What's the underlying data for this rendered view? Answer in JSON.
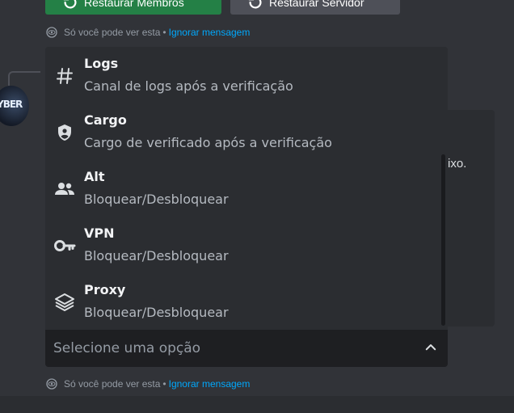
{
  "buttons": {
    "restore_members": "Restaurar Membros",
    "restore_server": "Restaurar Servidor"
  },
  "ephemeral": {
    "only_you": "Só você pode ver esta",
    "separator": "•",
    "dismiss": "Ignorar mensagem"
  },
  "avatar": {
    "text": "YBER"
  },
  "embed": {
    "partial_text": "ixo."
  },
  "menu": {
    "options": [
      {
        "icon": "hashtag-icon",
        "title": "Logs",
        "description": "Canal de logs após a verificação"
      },
      {
        "icon": "shield-user-icon",
        "title": "Cargo",
        "description": "Cargo de verificado após a verificação"
      },
      {
        "icon": "users-icon",
        "title": "Alt",
        "description": "Bloquear/Desbloquear"
      },
      {
        "icon": "key-icon",
        "title": "VPN",
        "description": "Bloquear/Desbloquear"
      },
      {
        "icon": "layers-icon",
        "title": "Proxy",
        "description": "Bloquear/Desbloquear"
      }
    ]
  },
  "select": {
    "placeholder": "Selecione uma opção"
  },
  "colors": {
    "background": "#313338",
    "menu_bg": "#2b2d31",
    "select_bg": "#1e1f22",
    "link": "#00a8fc",
    "success_button": "#248046",
    "secondary_button": "#4e5058"
  }
}
